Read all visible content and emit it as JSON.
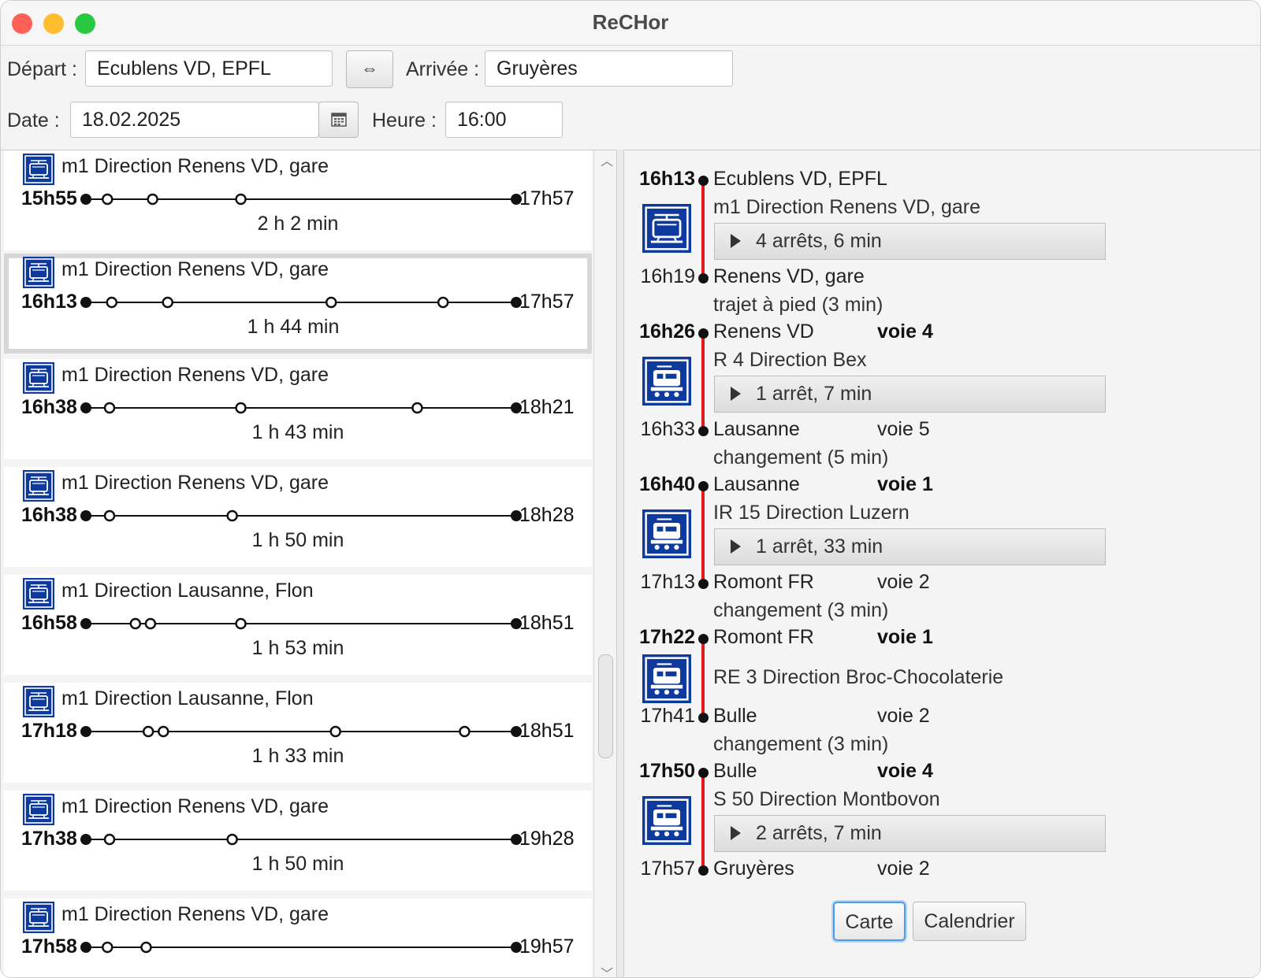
{
  "window": {
    "title": "ReCHor"
  },
  "form": {
    "depart_label": "Départ :",
    "depart_value": "Ecublens VD, EPFL",
    "swap_symbol": "⇔",
    "arrivee_label": "Arrivée :",
    "arrivee_value": "Gruyères",
    "date_label": "Date :",
    "date_value": "18.02.2025",
    "heure_label": "Heure :",
    "heure_value": "16:00"
  },
  "connections": [
    {
      "route": "m1 Direction Renens VD, gare",
      "dep": "15h55",
      "arr": "17h57",
      "duration": "2 h 2 min",
      "stops": [
        0.05,
        0.155,
        0.36
      ],
      "selected": false
    },
    {
      "route": "m1 Direction Renens VD, gare",
      "dep": "16h13",
      "arr": "17h57",
      "duration": "1 h 44 min",
      "stops": [
        0.06,
        0.19,
        0.57,
        0.83
      ],
      "selected": true
    },
    {
      "route": "m1 Direction Renens VD, gare",
      "dep": "16h38",
      "arr": "18h21",
      "duration": "1 h 43 min",
      "stops": [
        0.055,
        0.36,
        0.77
      ],
      "selected": false
    },
    {
      "route": "m1 Direction Renens VD, gare",
      "dep": "16h38",
      "arr": "18h28",
      "duration": "1 h 50 min",
      "stops": [
        0.055,
        0.34
      ],
      "selected": false
    },
    {
      "route": "m1 Direction Lausanne, Flon",
      "dep": "16h58",
      "arr": "18h51",
      "duration": "1 h 53 min",
      "stops": [
        0.115,
        0.15,
        0.36
      ],
      "selected": false
    },
    {
      "route": "m1 Direction Lausanne, Flon",
      "dep": "17h18",
      "arr": "18h51",
      "duration": "1 h 33 min",
      "stops": [
        0.145,
        0.18,
        0.58,
        0.88
      ],
      "selected": false
    },
    {
      "route": "m1 Direction Renens VD, gare",
      "dep": "17h38",
      "arr": "19h28",
      "duration": "1 h 50 min",
      "stops": [
        0.055,
        0.34
      ],
      "selected": false
    },
    {
      "route": "m1 Direction Renens VD, gare",
      "dep": "17h58",
      "arr": "19h57",
      "duration": "",
      "stops": [
        0.05,
        0.14
      ],
      "selected": false
    }
  ],
  "detail": {
    "legs": [
      {
        "dep_time": "16h13",
        "dep_station": "Ecublens VD, EPFL",
        "dep_platform": "",
        "route": "m1 Direction Renens VD, gare",
        "stops": "4 arrêts, 6 min",
        "vehicle": "metro",
        "arr_time": "16h19",
        "arr_station": "Renens VD, gare",
        "arr_platform": "",
        "after": "trajet à pied (3 min)"
      },
      {
        "dep_time": "16h26",
        "dep_station": "Renens VD",
        "dep_platform": "voie 4",
        "route": "R 4 Direction Bex",
        "stops": "1 arrêt, 7 min",
        "vehicle": "train",
        "arr_time": "16h33",
        "arr_station": "Lausanne",
        "arr_platform": "voie 5",
        "after": "changement (5 min)"
      },
      {
        "dep_time": "16h40",
        "dep_station": "Lausanne",
        "dep_platform": "voie 1",
        "route": "IR 15 Direction Luzern",
        "stops": "1 arrêt, 33 min",
        "vehicle": "train",
        "arr_time": "17h13",
        "arr_station": "Romont FR",
        "arr_platform": "voie 2",
        "after": "changement (3 min)"
      },
      {
        "dep_time": "17h22",
        "dep_station": "Romont FR",
        "dep_platform": "voie 1",
        "route": "RE 3 Direction Broc-Chocolaterie",
        "stops": "",
        "vehicle": "train",
        "arr_time": "17h41",
        "arr_station": "Bulle",
        "arr_platform": "voie 2",
        "after": "changement (3 min)"
      },
      {
        "dep_time": "17h50",
        "dep_station": "Bulle",
        "dep_platform": "voie 4",
        "route": "S 50 Direction Montbovon",
        "stops": "2 arrêts, 7 min",
        "vehicle": "train",
        "arr_time": "17h57",
        "arr_station": "Gruyères",
        "arr_platform": "voie 2",
        "after": ""
      }
    ],
    "buttons": {
      "map": "Carte",
      "calendar": "Calendrier"
    }
  },
  "colors": {
    "accent": "#0d3a9c",
    "journey_line": "#e01b1b",
    "focus": "#4a9be8"
  }
}
